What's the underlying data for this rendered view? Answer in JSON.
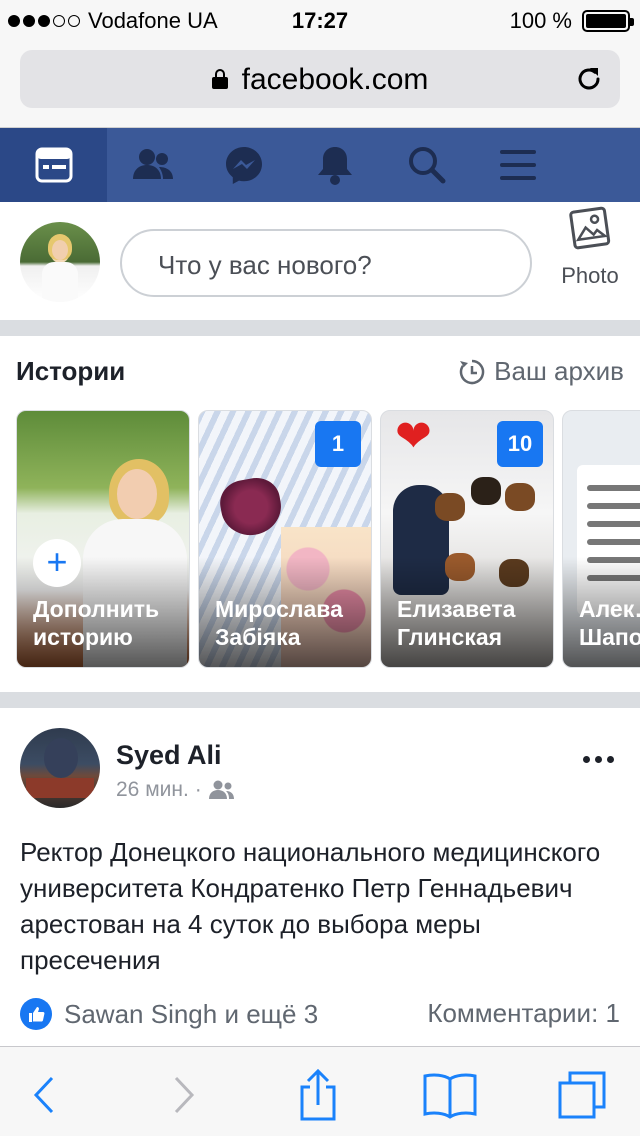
{
  "status_bar": {
    "carrier": "Vodafone UA",
    "time": "17:27",
    "battery": "100 %",
    "signal_bars_filled": 3,
    "signal_bars_total": 5
  },
  "browser": {
    "url": "facebook.com",
    "icons": [
      "lock-icon",
      "reload-icon"
    ]
  },
  "fb_nav": {
    "items": [
      {
        "icon": "news-feed-icon",
        "active": true
      },
      {
        "icon": "friends-icon",
        "active": false
      },
      {
        "icon": "messenger-icon",
        "active": false
      },
      {
        "icon": "notifications-icon",
        "active": false
      },
      {
        "icon": "search-icon",
        "active": false
      },
      {
        "icon": "menu-icon",
        "active": false
      }
    ],
    "colors": {
      "bar": "#3b5998",
      "active": "#2b4887"
    }
  },
  "composer": {
    "placeholder": "Что у вас нового?",
    "photo_label": "Photo"
  },
  "stories": {
    "title": "Истории",
    "archive_label": "Ваш архив",
    "items": [
      {
        "name": "Дополнить историю",
        "count": null,
        "kind": "add"
      },
      {
        "name": "Мирослава Забіяка",
        "count": "1"
      },
      {
        "name": "Елизавета Глинская",
        "count": "10"
      },
      {
        "name": "Алек… Шапо…",
        "count": null
      }
    ]
  },
  "post": {
    "author": "Syed Ali",
    "time": "26 мин.",
    "text": "Ректор Донецкого национального медицинского университета Кондратенко Петр Геннадьевич арестован на 4 суток до выбора меры пресечения",
    "likes": "Sawan Singh и ещё 3",
    "comments": "Комментарии: 1"
  },
  "toolbar": {
    "icons": [
      "back-icon",
      "forward-icon",
      "share-icon",
      "bookmarks-icon",
      "tabs-icon"
    ],
    "accent": "#1a82fb"
  }
}
